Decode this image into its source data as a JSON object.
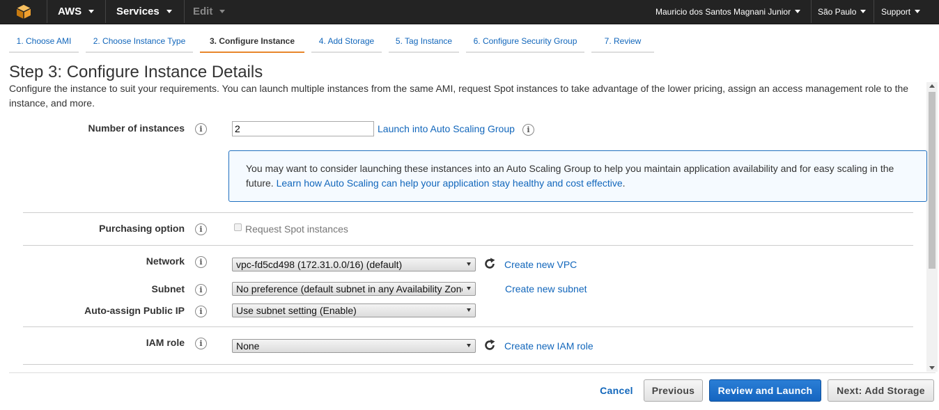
{
  "topnav": {
    "logo_icon": "aws-cube-icon",
    "aws_label": "AWS",
    "services_label": "Services",
    "edit_label": "Edit",
    "user_label": "Mauricio dos Santos Magnani Junior",
    "region_label": "São Paulo",
    "support_label": "Support",
    "brand_color": "#f0a030"
  },
  "steps": [
    {
      "label": "1. Choose AMI"
    },
    {
      "label": "2. Choose Instance Type"
    },
    {
      "label": "3. Configure Instance",
      "active": true
    },
    {
      "label": "4. Add Storage"
    },
    {
      "label": "5. Tag Instance"
    },
    {
      "label": "6. Configure Security Group"
    },
    {
      "label": "7. Review"
    }
  ],
  "page": {
    "title": "Step 3: Configure Instance Details",
    "description": "Configure the instance to suit your requirements. You can launch multiple instances from the same AMI, request Spot instances to take advantage of the lower pricing, assign an access management role to the instance, and more."
  },
  "form": {
    "instances": {
      "label": "Number of instances",
      "value": "2",
      "asg_link": "Launch into Auto Scaling Group"
    },
    "infobox": {
      "text": "You may want to consider launching these instances into an Auto Scaling Group to help you maintain application availability and for easy scaling in the future.",
      "link": "Learn how Auto Scaling can help your application stay healthy and cost effective",
      "end": "."
    },
    "purchasing": {
      "label": "Purchasing option",
      "checkbox_label": "Request Spot instances"
    },
    "network": {
      "label": "Network",
      "value": "vpc-fd5cd498 (172.31.0.0/16) (default)",
      "create_link": "Create new VPC"
    },
    "subnet": {
      "label": "Subnet",
      "value": "No preference (default subnet in any Availability Zone)",
      "create_link": "Create new subnet"
    },
    "public_ip": {
      "label": "Auto-assign Public IP",
      "value": "Use subnet setting (Enable)"
    },
    "iam": {
      "label": "IAM role",
      "value": "None",
      "create_link": "Create new IAM role"
    },
    "info_glyph": "i"
  },
  "footer": {
    "cancel": "Cancel",
    "previous": "Previous",
    "review": "Review and Launch",
    "next": "Next: Add Storage"
  }
}
